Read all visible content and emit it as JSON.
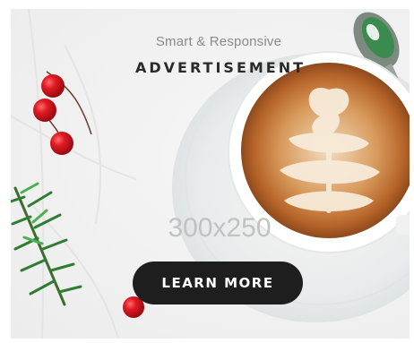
{
  "ad": {
    "subheadline": "Smart & Responsive",
    "headline": "ADVERTISEMENT",
    "size_label": "300x250",
    "cta_label": "LEARN MORE"
  },
  "colors": {
    "cta_background": "#1e1e1e",
    "cta_text": "#ffffff",
    "headline": "#2a2a2a",
    "subheadline": "#8a8a8a",
    "size_label": "#c2c2c2",
    "berry_red": "#d2121c",
    "coffee_crema": "#c8762b"
  },
  "icons": [
    "coffee-cup-image",
    "red-berries-image",
    "pine-branch-image",
    "spoon-image"
  ]
}
